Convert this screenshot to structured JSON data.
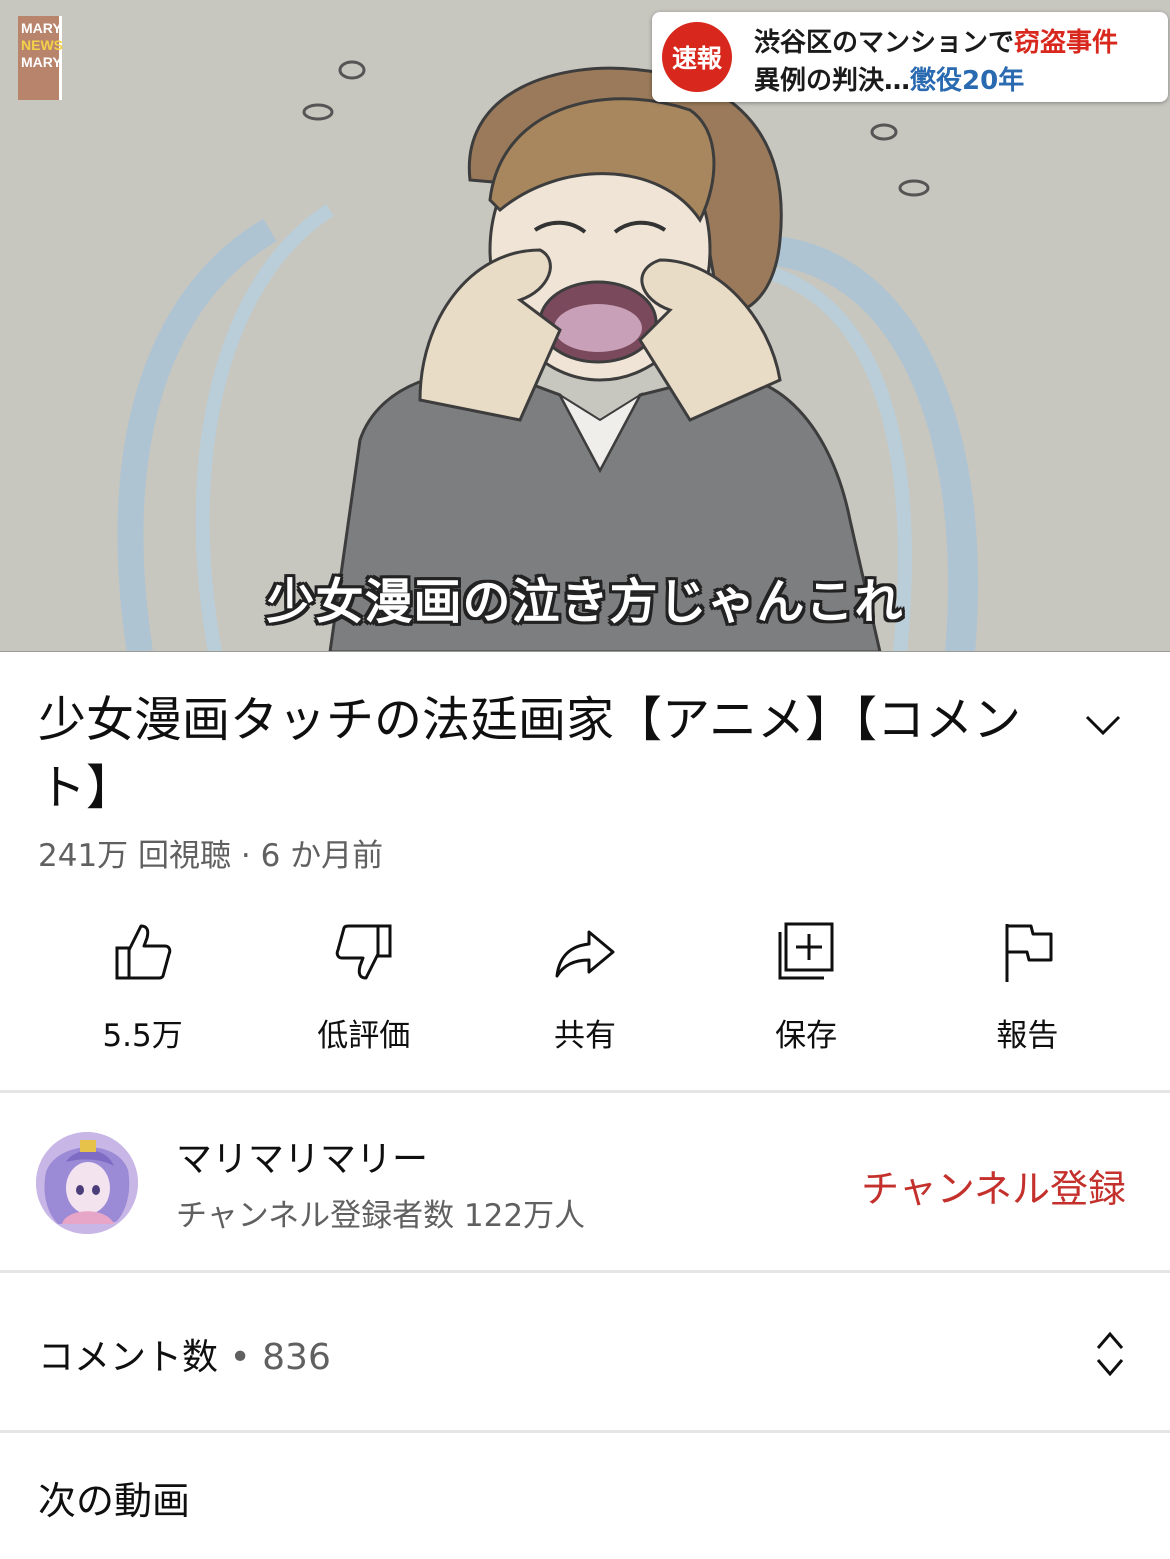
{
  "video": {
    "channel_logo": [
      "MARY",
      "NEWS",
      "MARY"
    ],
    "breaking_badge": "速報",
    "breaking_line1_a": "渋谷区のマンションで",
    "breaking_line1_b": "窃盗事件",
    "breaking_line2_a": "異例の判決…",
    "breaking_line2_b": "懲役20年",
    "caption": "少女漫画の泣き方じゃんこれ"
  },
  "title": "少女漫画タッチの法廷画家【アニメ】【コメント】",
  "meta": "241万 回視聴 · 6 か月前",
  "actions": [
    {
      "icon": "thumbs-up-icon",
      "label": "5.5万"
    },
    {
      "icon": "thumbs-down-icon",
      "label": "低評価"
    },
    {
      "icon": "share-icon",
      "label": "共有"
    },
    {
      "icon": "save-playlist-icon",
      "label": "保存"
    },
    {
      "icon": "flag-icon",
      "label": "報告"
    }
  ],
  "channel": {
    "name": "マリマリマリー",
    "subscribers": "チャンネル登録者数 122万人",
    "subscribe_label": "チャンネル登録"
  },
  "comments": {
    "label": "コメント数",
    "dot": "•",
    "count": "836"
  },
  "next_label": "次の動画",
  "colors": {
    "subscribe": "#c4302b",
    "breaking_red": "#d8281e",
    "breaking_blue": "#2a6ab0"
  }
}
